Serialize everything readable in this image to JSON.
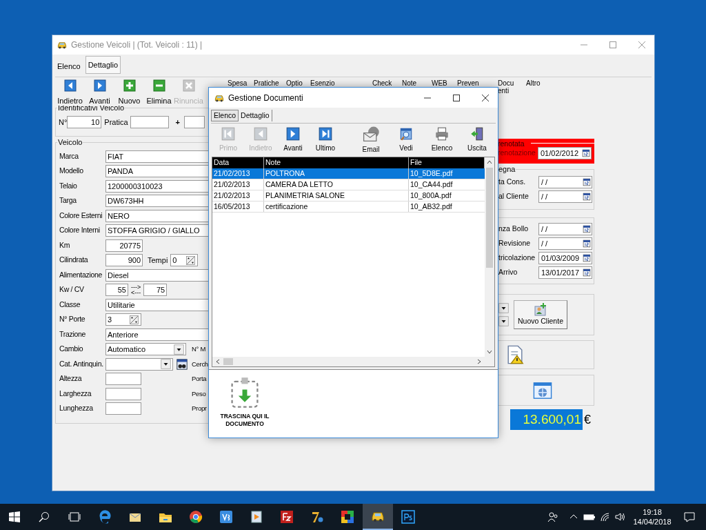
{
  "main_window": {
    "title": "Gestione Veicoli | (Tot. Veicoli : 11) |",
    "tabs": [
      {
        "label": "Elenco",
        "selected": false
      },
      {
        "label": "Dettaglio",
        "selected": true
      }
    ],
    "toolbar": [
      {
        "label": "Indietro",
        "kind": "prev",
        "disabled": false
      },
      {
        "label": "Avanti",
        "kind": "next",
        "disabled": false
      },
      {
        "label": "Nuovo",
        "kind": "add",
        "disabled": false
      },
      {
        "label": "Elimina",
        "kind": "remove",
        "disabled": false
      },
      {
        "label": "Rinuncia",
        "kind": "cancel",
        "disabled": true
      }
    ],
    "toolbar_text_buttons": [
      "Spesa",
      "Pratiche",
      "Optio",
      "Esenzio",
      "Check",
      "Note",
      "WEB",
      "Preven"
    ],
    "toolbar_right_buttons": [
      {
        "lines": [
          "Docu",
          "enti"
        ]
      },
      {
        "lines": [
          "Altro"
        ]
      }
    ],
    "identificativi": {
      "legend": "Identificativi Veicolo",
      "number_label": "N°",
      "number": "10",
      "pratica_label": "Pratica",
      "plus": "+"
    },
    "veicolo": {
      "legend": "Veicolo",
      "rows": [
        {
          "label": "Marca",
          "kind": "text",
          "value": "FIAT"
        },
        {
          "label": "Modello",
          "kind": "text",
          "value": "PANDA"
        },
        {
          "label": "Telaio",
          "kind": "text",
          "value": "1200000310023"
        },
        {
          "label": "Targa",
          "kind": "text",
          "value": "DW673HH"
        },
        {
          "label": "Colore Esterni",
          "kind": "text",
          "value": "NERO"
        },
        {
          "label": "Colore Interni",
          "kind": "text",
          "value": "STOFFA GRIGIO / GIALLO"
        },
        {
          "label": "Km",
          "kind": "number",
          "value": "20775"
        },
        {
          "label": "Cilindrata",
          "kind": "number",
          "value": "900",
          "extra_label": "Tempi",
          "extra_value": "0"
        },
        {
          "label": "Alimentazione",
          "kind": "text",
          "value": "Diesel"
        },
        {
          "label": "Kw / CV",
          "kind": "pair",
          "value": "55",
          "value2": "75",
          "arrow_right": "--->",
          "arrow_left": "<---"
        },
        {
          "label": "Classe",
          "kind": "text",
          "value": "Utilitarie"
        },
        {
          "label": "N° Porte",
          "kind": "spin",
          "value": "3"
        },
        {
          "label": "Trazione",
          "kind": "text",
          "value": "Anteriore"
        },
        {
          "label": "Cambio",
          "kind": "combo",
          "value": "Automatico",
          "side": "N° M"
        },
        {
          "label": "Cat. Antinquin.",
          "kind": "combo_search",
          "side": "Cerch"
        },
        {
          "label": "Altezza",
          "kind": "empty",
          "side": "Porta"
        },
        {
          "label": "Larghezza",
          "kind": "empty",
          "side": "Peso"
        },
        {
          "label": "Lunghezza",
          "kind": "empty",
          "side": "Propr"
        }
      ]
    },
    "prenotata": {
      "legend": "renotata",
      "label": "renotazione",
      "date": "01/02/2012"
    },
    "date_groups": [
      {
        "legend": "egna",
        "fields": [
          {
            "label": "ta Cons.",
            "date": "/ /"
          },
          {
            "label": "al Cliente",
            "date": "/ /"
          }
        ]
      },
      {
        "fields": [
          {
            "label": "nza Bollo",
            "date": "/ /"
          },
          {
            "label": "Revisione",
            "date": "/ /"
          },
          {
            "label": "tricolazione",
            "date": "01/03/2009"
          },
          {
            "label": "Arrivo",
            "date": "13/01/2017"
          }
        ]
      }
    ],
    "cliente_button": "Nuovo Cliente",
    "price": {
      "value": "13.600,01",
      "currency": "€"
    }
  },
  "dialog": {
    "title": "Gestione Documenti",
    "tabs": [
      {
        "label": "Elenco",
        "selected": true
      },
      {
        "label": "Dettaglio",
        "selected": false
      }
    ],
    "toolbar": [
      {
        "label": "Primo",
        "kind": "first",
        "disabled": true
      },
      {
        "label": "Indietro",
        "kind": "prev",
        "disabled": true
      },
      {
        "label": "Avanti",
        "kind": "next",
        "disabled": false
      },
      {
        "label": "Ultimo",
        "kind": "last",
        "disabled": false
      },
      {
        "label": "Email",
        "kind": "email",
        "disabled": false
      },
      {
        "label": "Vedi",
        "kind": "view",
        "disabled": false
      },
      {
        "label": "Elenco",
        "kind": "print",
        "disabled": false
      },
      {
        "label": "Uscita",
        "kind": "exit",
        "disabled": false
      }
    ],
    "table": {
      "columns": [
        "Data",
        "Note",
        "File"
      ],
      "rows": [
        {
          "data": "21/02/2013",
          "note": "POLTRONA",
          "file": "10_5D8E.pdf",
          "selected": true
        },
        {
          "data": "21/02/2013",
          "note": "CAMERA DA LETTO",
          "file": "10_CA44.pdf",
          "selected": false
        },
        {
          "data": "21/02/2013",
          "note": "PLANIMETRIA SALONE",
          "file": "10_800A.pdf",
          "selected": false
        },
        {
          "data": "16/05/2013",
          "note": "certificazione",
          "file": "10_AB32.pdf",
          "selected": false
        }
      ]
    },
    "drop_label": "TRASCINA QUI IL DOCUMENTO"
  },
  "taskbar": {
    "apps": [
      {
        "kind": "edge",
        "selected": false
      },
      {
        "kind": "mail",
        "selected": false
      },
      {
        "kind": "folder",
        "selected": false
      },
      {
        "kind": "chrome",
        "selected": false
      },
      {
        "kind": "vs",
        "selected": false
      },
      {
        "kind": "media",
        "selected": false
      },
      {
        "kind": "ftp",
        "selected": false
      },
      {
        "kind": "zip",
        "selected": false
      },
      {
        "kind": "grid",
        "selected": false
      },
      {
        "kind": "car",
        "selected": true
      },
      {
        "kind": "ps",
        "selected": false
      }
    ],
    "time": "19:18",
    "date": "14/04/2018"
  }
}
